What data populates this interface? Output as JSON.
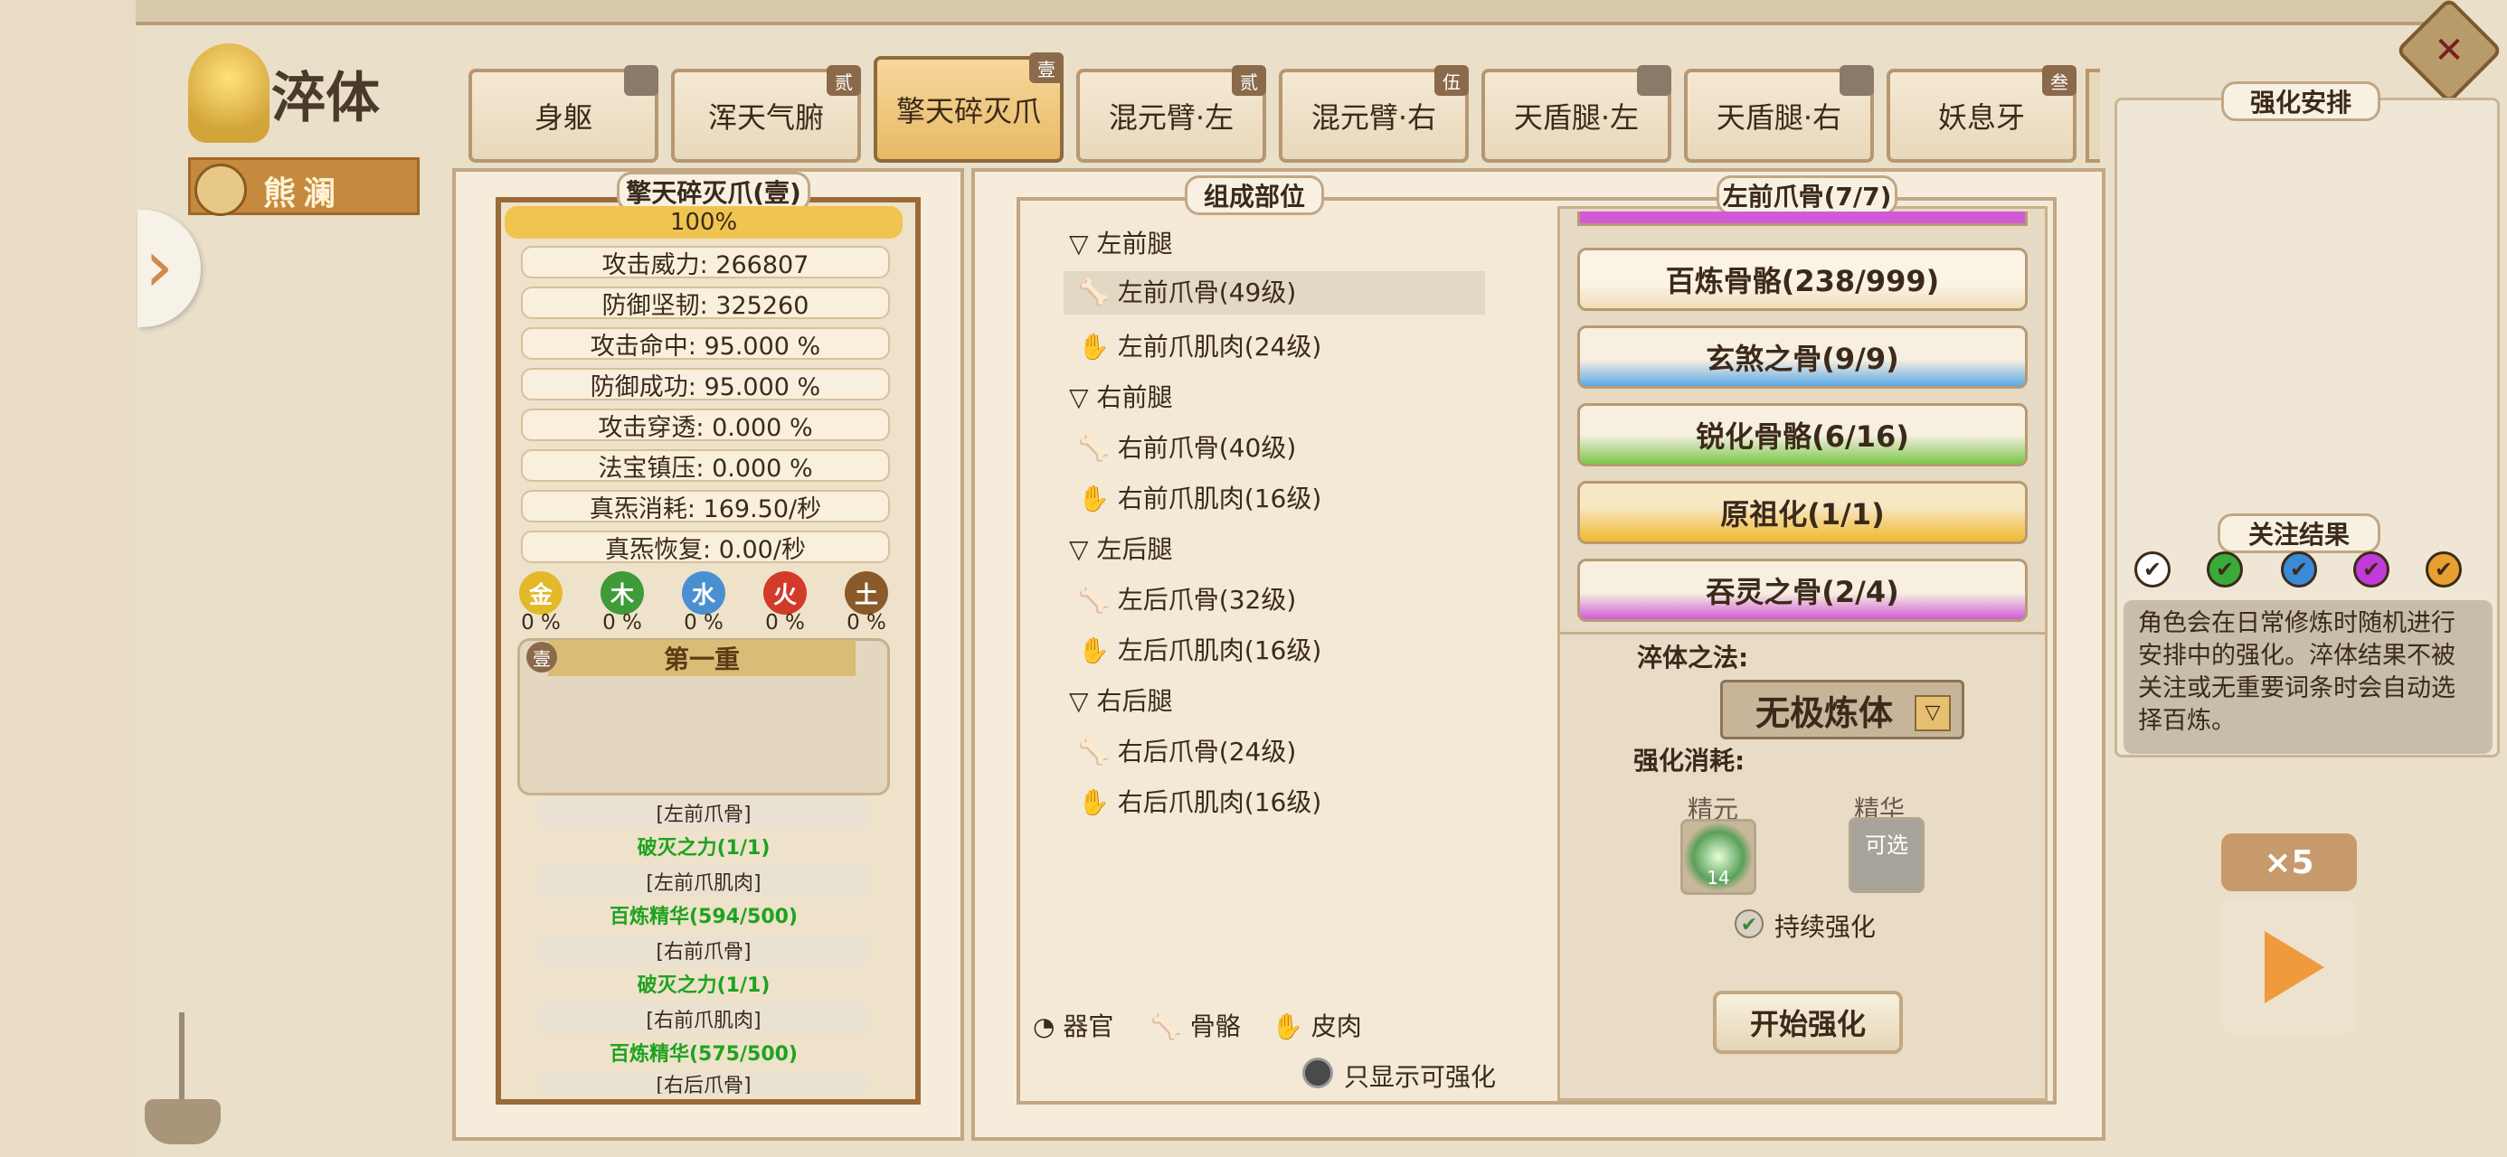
{
  "header": {
    "title": "淬体",
    "character": "熊澜"
  },
  "tabs": [
    {
      "label": "身躯",
      "badge": ""
    },
    {
      "label": "浑天气腑",
      "badge": "贰"
    },
    {
      "label": "擎天碎灭爪",
      "badge": "壹"
    },
    {
      "label": "混元臂·左",
      "badge": "贰"
    },
    {
      "label": "混元臂·右",
      "badge": "伍"
    },
    {
      "label": "天盾腿·左",
      "badge": ""
    },
    {
      "label": "天盾腿·右",
      "badge": ""
    },
    {
      "label": "妖息牙",
      "badge": "叁"
    }
  ],
  "left_panel": {
    "title": "擎天碎灭爪(壹)",
    "progress_text": "100%",
    "stats": [
      "攻击威力: 266807",
      "防御坚韧: 325260",
      "攻击命中: 95.000 %",
      "防御成功: 95.000 %",
      "攻击穿透: 0.000 %",
      "法宝镇压: 0.000 %",
      "真炁消耗: 169.50/秒",
      "真炁恢复: 0.00/秒"
    ],
    "elements": [
      {
        "name": "金",
        "pct": "0 %",
        "color": "#e3b92a"
      },
      {
        "name": "木",
        "pct": "0 %",
        "color": "#3f9a3a"
      },
      {
        "name": "水",
        "pct": "0 %",
        "color": "#4a90d0"
      },
      {
        "name": "火",
        "pct": "0 %",
        "color": "#d23a2a"
      },
      {
        "name": "土",
        "pct": "0 %",
        "color": "#8a5a2a"
      }
    ],
    "layer_badge": "壹",
    "layer_title": "第一重",
    "bonus_rows": [
      {
        "part": "[左前爪骨]",
        "effect": "破灭之力(1/1)"
      },
      {
        "part": "[左前爪肌肉]",
        "effect": "百炼精华(594/500)"
      },
      {
        "part": "[右前爪骨]",
        "effect": "破灭之力(1/1)"
      },
      {
        "part": "[右前爪肌肉]",
        "effect": "百炼精华(575/500)"
      }
    ],
    "trailing_row": "[右后爪骨]"
  },
  "mid_panel": {
    "title": "组成部位",
    "tree": [
      {
        "group": "左前腿",
        "items": [
          "左前爪骨(49级)",
          "左前爪肌肉(24级)"
        ]
      },
      {
        "group": "右前腿",
        "items": [
          "右前爪骨(40级)",
          "右前爪肌肉(16级)"
        ]
      },
      {
        "group": "左后腿",
        "items": [
          "左后爪骨(32级)",
          "左后爪肌肉(16级)"
        ]
      },
      {
        "group": "右后腿",
        "items": [
          "右后爪骨(24级)",
          "右后爪肌肉(16级)"
        ]
      }
    ],
    "legend": [
      "器官",
      "骨骼",
      "皮肉"
    ],
    "filter_label": "只显示可强化"
  },
  "detail_panel": {
    "title": "左前爪骨(7/7)",
    "options": [
      {
        "label": "百炼骨骼(238/999)",
        "color": "#f3e4c8"
      },
      {
        "label": "玄煞之骨(9/9)",
        "color": "#5aa8e6"
      },
      {
        "label": "锐化骨骼(6/16)",
        "color": "#7ac84a"
      },
      {
        "label": "原祖化(1/1)",
        "color": "#f0b830"
      },
      {
        "label": "吞灵之骨(2/4)",
        "color": "#d25ad8"
      }
    ],
    "method_label": "淬体之法:",
    "method_value": "无极炼体",
    "cost_label": "强化消耗:",
    "cost1_name": "精元",
    "cost1_count": "14",
    "cost2_name": "精华",
    "cost2_value": "可选",
    "continuous_label": "持续强化",
    "start_button": "开始强化"
  },
  "arrange_panel": {
    "title": "强化安排",
    "focus_title": "关注结果",
    "focus_colors": [
      "#ffffff",
      "#3aaa3a",
      "#3a8ad8",
      "#c23ad8",
      "#e8a030"
    ],
    "tip": "角色会在日常修炼时随机进行安排中的强化。淬体结果不被关注或无重要词条时会自动选择百炼。",
    "multiplier": "×5"
  }
}
